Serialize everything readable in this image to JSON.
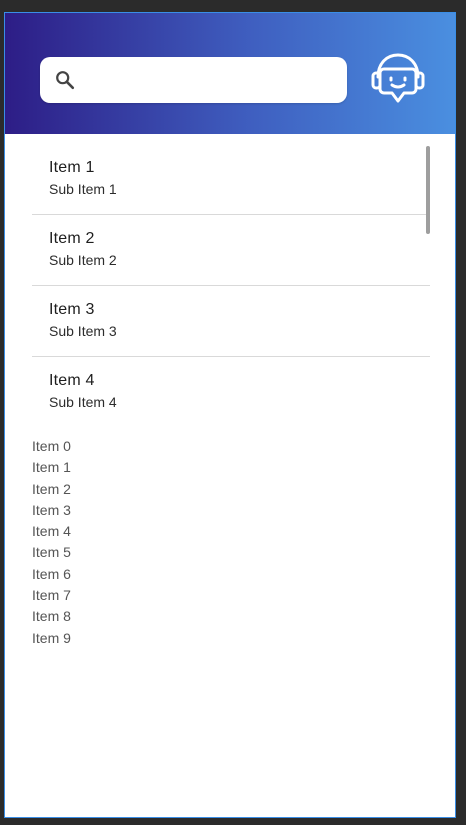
{
  "header": {
    "search": {
      "placeholder": "",
      "value": ""
    },
    "icons": {
      "search": "search-icon",
      "assistant": "support-bot-icon"
    },
    "colors": {
      "gradient_start": "#2d1d86",
      "gradient_end": "#4a8fe0"
    }
  },
  "cards": [
    {
      "title": "Item 1",
      "subtitle": "Sub Item 1"
    },
    {
      "title": "Item 2",
      "subtitle": "Sub Item 2"
    },
    {
      "title": "Item 3",
      "subtitle": "Sub Item 3"
    },
    {
      "title": "Item 4",
      "subtitle": "Sub Item 4"
    }
  ],
  "simple_list": [
    "Item 0",
    "Item 1",
    "Item 2",
    "Item 3",
    "Item 4",
    "Item 5",
    "Item 6",
    "Item 7",
    "Item 8",
    "Item 9"
  ]
}
